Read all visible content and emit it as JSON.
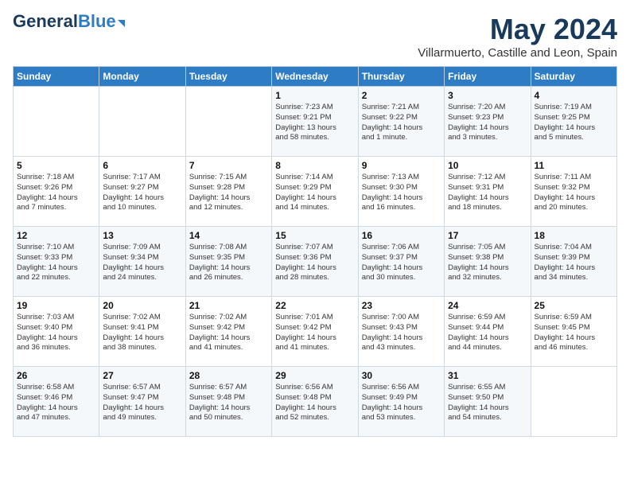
{
  "logo": {
    "line1": "General",
    "line2": "Blue"
  },
  "header": {
    "month": "May 2024",
    "location": "Villarmuerto, Castille and Leon, Spain"
  },
  "weekdays": [
    "Sunday",
    "Monday",
    "Tuesday",
    "Wednesday",
    "Thursday",
    "Friday",
    "Saturday"
  ],
  "weeks": [
    [
      {
        "day": "",
        "info": ""
      },
      {
        "day": "",
        "info": ""
      },
      {
        "day": "",
        "info": ""
      },
      {
        "day": "1",
        "info": "Sunrise: 7:23 AM\nSunset: 9:21 PM\nDaylight: 13 hours\nand 58 minutes."
      },
      {
        "day": "2",
        "info": "Sunrise: 7:21 AM\nSunset: 9:22 PM\nDaylight: 14 hours\nand 1 minute."
      },
      {
        "day": "3",
        "info": "Sunrise: 7:20 AM\nSunset: 9:23 PM\nDaylight: 14 hours\nand 3 minutes."
      },
      {
        "day": "4",
        "info": "Sunrise: 7:19 AM\nSunset: 9:25 PM\nDaylight: 14 hours\nand 5 minutes."
      }
    ],
    [
      {
        "day": "5",
        "info": "Sunrise: 7:18 AM\nSunset: 9:26 PM\nDaylight: 14 hours\nand 7 minutes."
      },
      {
        "day": "6",
        "info": "Sunrise: 7:17 AM\nSunset: 9:27 PM\nDaylight: 14 hours\nand 10 minutes."
      },
      {
        "day": "7",
        "info": "Sunrise: 7:15 AM\nSunset: 9:28 PM\nDaylight: 14 hours\nand 12 minutes."
      },
      {
        "day": "8",
        "info": "Sunrise: 7:14 AM\nSunset: 9:29 PM\nDaylight: 14 hours\nand 14 minutes."
      },
      {
        "day": "9",
        "info": "Sunrise: 7:13 AM\nSunset: 9:30 PM\nDaylight: 14 hours\nand 16 minutes."
      },
      {
        "day": "10",
        "info": "Sunrise: 7:12 AM\nSunset: 9:31 PM\nDaylight: 14 hours\nand 18 minutes."
      },
      {
        "day": "11",
        "info": "Sunrise: 7:11 AM\nSunset: 9:32 PM\nDaylight: 14 hours\nand 20 minutes."
      }
    ],
    [
      {
        "day": "12",
        "info": "Sunrise: 7:10 AM\nSunset: 9:33 PM\nDaylight: 14 hours\nand 22 minutes."
      },
      {
        "day": "13",
        "info": "Sunrise: 7:09 AM\nSunset: 9:34 PM\nDaylight: 14 hours\nand 24 minutes."
      },
      {
        "day": "14",
        "info": "Sunrise: 7:08 AM\nSunset: 9:35 PM\nDaylight: 14 hours\nand 26 minutes."
      },
      {
        "day": "15",
        "info": "Sunrise: 7:07 AM\nSunset: 9:36 PM\nDaylight: 14 hours\nand 28 minutes."
      },
      {
        "day": "16",
        "info": "Sunrise: 7:06 AM\nSunset: 9:37 PM\nDaylight: 14 hours\nand 30 minutes."
      },
      {
        "day": "17",
        "info": "Sunrise: 7:05 AM\nSunset: 9:38 PM\nDaylight: 14 hours\nand 32 minutes."
      },
      {
        "day": "18",
        "info": "Sunrise: 7:04 AM\nSunset: 9:39 PM\nDaylight: 14 hours\nand 34 minutes."
      }
    ],
    [
      {
        "day": "19",
        "info": "Sunrise: 7:03 AM\nSunset: 9:40 PM\nDaylight: 14 hours\nand 36 minutes."
      },
      {
        "day": "20",
        "info": "Sunrise: 7:02 AM\nSunset: 9:41 PM\nDaylight: 14 hours\nand 38 minutes."
      },
      {
        "day": "21",
        "info": "Sunrise: 7:02 AM\nSunset: 9:42 PM\nDaylight: 14 hours\nand 41 minutes."
      },
      {
        "day": "22",
        "info": "Sunrise: 7:01 AM\nSunset: 9:42 PM\nDaylight: 14 hours\nand 41 minutes."
      },
      {
        "day": "23",
        "info": "Sunrise: 7:00 AM\nSunset: 9:43 PM\nDaylight: 14 hours\nand 43 minutes."
      },
      {
        "day": "24",
        "info": "Sunrise: 6:59 AM\nSunset: 9:44 PM\nDaylight: 14 hours\nand 44 minutes."
      },
      {
        "day": "25",
        "info": "Sunrise: 6:59 AM\nSunset: 9:45 PM\nDaylight: 14 hours\nand 46 minutes."
      }
    ],
    [
      {
        "day": "26",
        "info": "Sunrise: 6:58 AM\nSunset: 9:46 PM\nDaylight: 14 hours\nand 47 minutes."
      },
      {
        "day": "27",
        "info": "Sunrise: 6:57 AM\nSunset: 9:47 PM\nDaylight: 14 hours\nand 49 minutes."
      },
      {
        "day": "28",
        "info": "Sunrise: 6:57 AM\nSunset: 9:48 PM\nDaylight: 14 hours\nand 50 minutes."
      },
      {
        "day": "29",
        "info": "Sunrise: 6:56 AM\nSunset: 9:48 PM\nDaylight: 14 hours\nand 52 minutes."
      },
      {
        "day": "30",
        "info": "Sunrise: 6:56 AM\nSunset: 9:49 PM\nDaylight: 14 hours\nand 53 minutes."
      },
      {
        "day": "31",
        "info": "Sunrise: 6:55 AM\nSunset: 9:50 PM\nDaylight: 14 hours\nand 54 minutes."
      },
      {
        "day": "",
        "info": ""
      }
    ]
  ]
}
